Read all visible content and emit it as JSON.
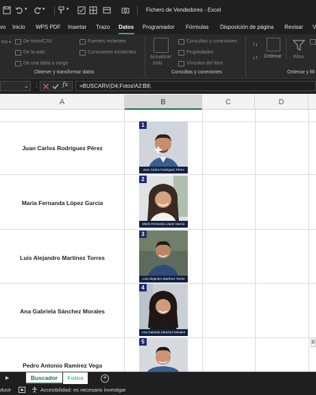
{
  "app": {
    "title": "Fichero de Vendedores  -  Excel"
  },
  "menu": {
    "items": [
      "vo",
      "Inicio",
      "WPS PDF",
      "Insertar",
      "Trazo",
      "Datos",
      "Programador",
      "Fórmulas",
      "Disposición de página",
      "Revisar",
      "V"
    ],
    "active": "Datos"
  },
  "ribbon": {
    "get_data": {
      "rows": [
        "De texto/CSV",
        "De la web",
        "De una tabla o rango"
      ],
      "side_label": "tos"
    },
    "recent": {
      "rows": [
        "Fuentes recientes",
        "Conexiones existentes"
      ]
    },
    "refresh": {
      "label_line1": "Actualizar",
      "label_line2": "todo"
    },
    "queries": {
      "rows": [
        "Consultas y conexiones",
        "Propiedades",
        "Vínculos del libro"
      ]
    },
    "sort": {
      "label": "Ordenar"
    },
    "filter": {
      "label": "Filtro"
    },
    "groups": [
      "Obtener y transformar datos",
      "Consultas y conexiones",
      "Ordenar y filt"
    ]
  },
  "formula_bar": {
    "formula": "=BUSCARV(D4;Fotos!A2:B8;"
  },
  "columns": [
    "A",
    "B",
    "C",
    "D"
  ],
  "rows": [
    {
      "name": "Juan Carlos Rodríguez Pérez",
      "num": "1",
      "caption": "Juan Carlos Rodríguez Pérez"
    },
    {
      "name": "María Fernanda López García",
      "num": "2",
      "caption": "María Fernanda López García"
    },
    {
      "name": "Luis Alejandro Martínez Torres",
      "num": "3",
      "caption": "Luis Alejandro Martínez Torres"
    },
    {
      "name": "Ana Gabriela Sánchez Morales",
      "num": "4",
      "caption": "Ana Gabriela Sánchez Morales"
    },
    {
      "name": "Pedro Antonio Ramírez Vega",
      "num": "5",
      "caption": ""
    }
  ],
  "side_tab_label": "B",
  "sheets": [
    "Buscador",
    "Fotos"
  ],
  "status": {
    "mode": "ducir",
    "accessibility": "Accesibilidad: es necesario investigar"
  },
  "colors": {
    "accent_green": "#1e7145",
    "card_blue": "#1d2b73",
    "caption_bg": "#122142"
  }
}
